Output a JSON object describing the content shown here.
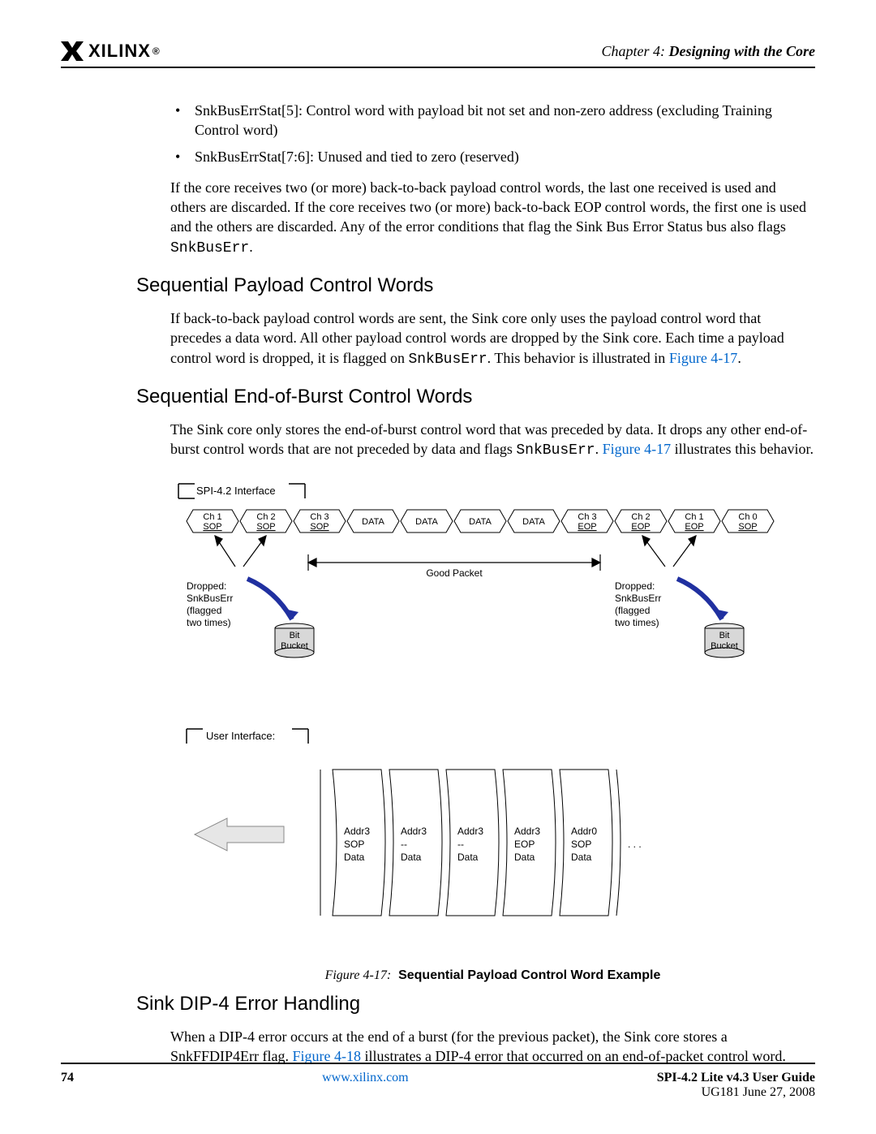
{
  "header": {
    "chapter_prefix": "Chapter 4:",
    "chapter_title": "Designing with the Core",
    "logo_text": "XILINX",
    "logo_reg": "®"
  },
  "bullets": {
    "b1": "SnkBusErrStat[5]: Control word with payload bit not set and non-zero address (excluding Training Control word)",
    "b2": "SnkBusErrStat[7:6]: Unused and tied to zero (reserved)"
  },
  "p1a": "If the core receives two (or more) back-to-back payload control words, the last one received is used and others are discarded. If the core receives two (or more) back-to-back EOP control words, the first one is used and the others are discarded. Any of the error conditions that flag the Sink Bus Error Status bus also flags ",
  "p1code": "SnkBusErr",
  "p1b": ".",
  "h_seq_payload": "Sequential Payload Control Words",
  "p2a": "If back-to-back payload control words are sent, the Sink core only uses the payload control word that precedes a data word. All other payload control words are dropped by the Sink core. Each time a payload control word is dropped, it is flagged on ",
  "p2code": "SnkBusErr",
  "p2b": ". This behavior is illustrated in ",
  "p2link": "Figure 4-17",
  "p2c": ".",
  "h_seq_eob": "Sequential End-of-Burst Control Words",
  "p3a": "The Sink core only stores the end-of-burst control word that was preceded by data. It drops any other end-of-burst control words that are not preceded by data and flags ",
  "p3code": "SnkBusErr",
  "p3b": ". ",
  "p3link": "Figure 4-17",
  "p3c": " illustrates this behavior.",
  "fig": {
    "spi_label": "SPI-4.2 Interface",
    "user_label": "User Interface:",
    "good_packet": "Good Packet",
    "dropped_l1": "Dropped:",
    "dropped_l2": "SnkBusErr",
    "dropped_l3": "(flagged",
    "dropped_l4": "two times)",
    "bucket_l1": "Bit",
    "bucket_l2": "Bucket",
    "cells": {
      "c1a": "Ch 1",
      "c1b": "SOP",
      "c2a": "Ch 2",
      "c2b": "SOP",
      "c3a": "Ch 3",
      "c3b": "SOP",
      "d": "DATA",
      "c4a": "Ch 3",
      "c4b": "EOP",
      "c5a": "Ch 2",
      "c5b": "EOP",
      "c6a": "Ch 1",
      "c6b": "EOP",
      "c7a": "Ch 0",
      "c7b": "SOP"
    },
    "ui": {
      "addr3": "Addr3",
      "addr0": "Addr0",
      "sop": "SOP",
      "eop": "EOP",
      "dash": "--",
      "data": "Data",
      "dots": ". . ."
    },
    "caption_num": "Figure 4-17:",
    "caption_txt": "Sequential Payload Control Word Example"
  },
  "h_dip4": "Sink DIP-4 Error Handling",
  "p4a": "When a DIP-4 error occurs at the end of a burst (for the previous packet), the Sink core stores a SnkFFDIP4Err flag. ",
  "p4link": "Figure 4-18",
  "p4b": " illustrates a DIP-4 error that occurred on an end-of-packet control word.",
  "footer": {
    "page": "74",
    "url": "www.xilinx.com",
    "guide": "SPI-4.2 Lite v4.3 User Guide",
    "doc": "UG181 June 27, 2008"
  }
}
